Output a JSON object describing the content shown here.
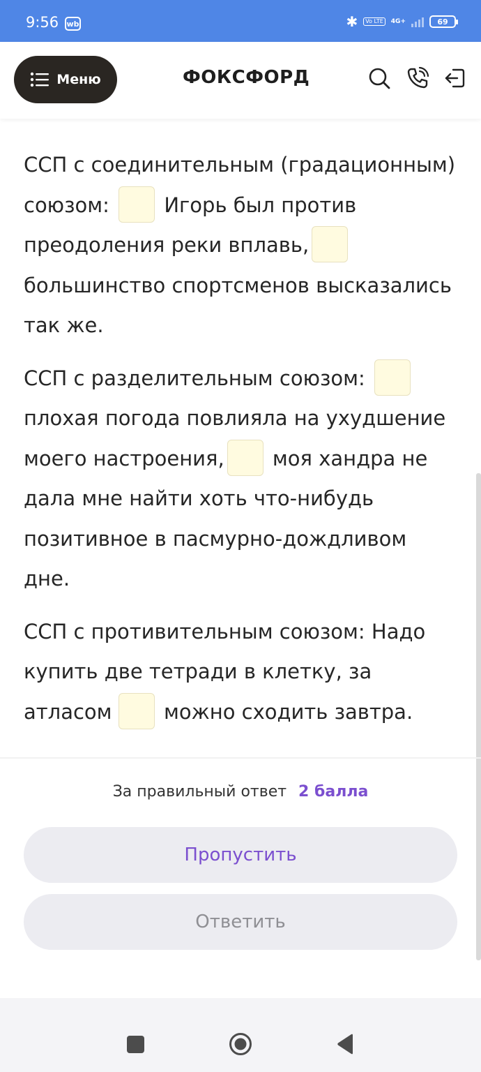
{
  "status_bar": {
    "time": "9:56",
    "app_badge": "wb",
    "volte": "Vo LTE",
    "network": "4G+",
    "battery": "69"
  },
  "header": {
    "menu_label": "Меню",
    "logo": "ФОКСФОРД"
  },
  "exercise": {
    "p1": {
      "a": "ССП с соединительным (градационным) союзом:",
      "b": "Игорь был против преодоления реки вплавь,",
      "c": "большинство спортсменов высказались так же."
    },
    "p2": {
      "a": "ССП с разделительным союзом:",
      "b": "плохая погода повлияла на ухудшение моего настроения,",
      "c": "моя хандра не дала мне найти хоть что-нибудь позитивное в пасмурно-дождливом дне."
    },
    "p3": {
      "a": "ССП с противительным союзом: Надо купить две тетради в клетку, за атласом",
      "b": "можно сходить завтра."
    }
  },
  "footer": {
    "points_label": "За правильный ответ",
    "points_value": "2 балла",
    "skip_label": "Пропустить",
    "answer_label": "Ответить"
  },
  "colors": {
    "status_bar": "#4f86e6",
    "menu_button": "#2a2622",
    "accent": "#7b4fcf",
    "blank_fill": "#fffbe0",
    "button_bg": "#ececf1"
  },
  "icons": [
    "search-icon",
    "phone-icon",
    "logout-icon",
    "menu-icon",
    "bluetooth-icon"
  ]
}
